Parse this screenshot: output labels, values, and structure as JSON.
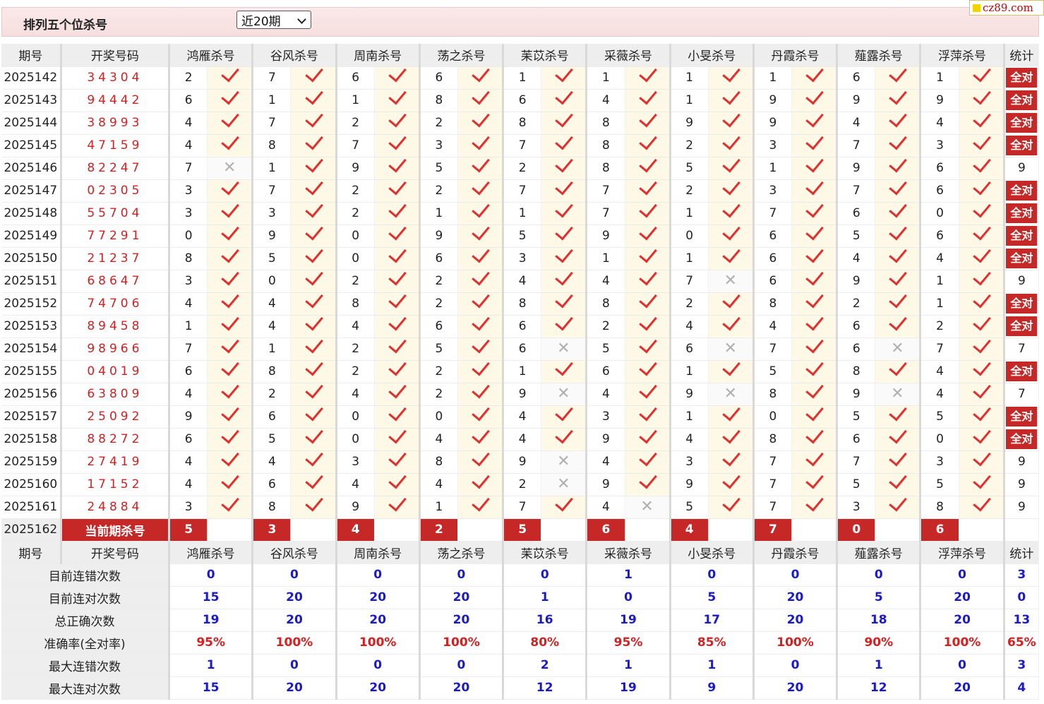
{
  "header": {
    "title": "排列五个位杀号",
    "period_select": "近20期",
    "logo": "cz89.com"
  },
  "columns": {
    "issue": "期号",
    "draw": "开奖号码",
    "experts": [
      "鸿雁杀号",
      "谷风杀号",
      "周南杀号",
      "荡之杀号",
      "苿苡杀号",
      "采薇杀号",
      "小旻杀号",
      "丹霞杀号",
      "薤露杀号",
      "浮萍杀号"
    ],
    "stat": "统计"
  },
  "rows": [
    {
      "issue": "2025142",
      "draw": "34304",
      "kills": [
        [
          "2",
          1
        ],
        [
          "7",
          1
        ],
        [
          "6",
          1
        ],
        [
          "6",
          1
        ],
        [
          "1",
          1
        ],
        [
          "1",
          1
        ],
        [
          "1",
          1
        ],
        [
          "1",
          1
        ],
        [
          "6",
          1
        ],
        [
          "1",
          1
        ]
      ],
      "stat": "全对"
    },
    {
      "issue": "2025143",
      "draw": "94442",
      "kills": [
        [
          "6",
          1
        ],
        [
          "1",
          1
        ],
        [
          "1",
          1
        ],
        [
          "8",
          1
        ],
        [
          "6",
          1
        ],
        [
          "4",
          1
        ],
        [
          "1",
          1
        ],
        [
          "9",
          1
        ],
        [
          "9",
          1
        ],
        [
          "9",
          1
        ]
      ],
      "stat": "全对"
    },
    {
      "issue": "2025144",
      "draw": "38993",
      "kills": [
        [
          "4",
          1
        ],
        [
          "7",
          1
        ],
        [
          "2",
          1
        ],
        [
          "2",
          1
        ],
        [
          "8",
          1
        ],
        [
          "8",
          1
        ],
        [
          "9",
          1
        ],
        [
          "9",
          1
        ],
        [
          "4",
          1
        ],
        [
          "4",
          1
        ]
      ],
      "stat": "全对"
    },
    {
      "issue": "2025145",
      "draw": "47159",
      "kills": [
        [
          "4",
          1
        ],
        [
          "8",
          1
        ],
        [
          "7",
          1
        ],
        [
          "3",
          1
        ],
        [
          "7",
          1
        ],
        [
          "8",
          1
        ],
        [
          "2",
          1
        ],
        [
          "3",
          1
        ],
        [
          "7",
          1
        ],
        [
          "3",
          1
        ]
      ],
      "stat": "全对"
    },
    {
      "issue": "2025146",
      "draw": "82247",
      "kills": [
        [
          "7",
          0
        ],
        [
          "1",
          1
        ],
        [
          "9",
          1
        ],
        [
          "5",
          1
        ],
        [
          "2",
          1
        ],
        [
          "8",
          1
        ],
        [
          "5",
          1
        ],
        [
          "1",
          1
        ],
        [
          "9",
          1
        ],
        [
          "6",
          1
        ]
      ],
      "stat": "9"
    },
    {
      "issue": "2025147",
      "draw": "02305",
      "kills": [
        [
          "3",
          1
        ],
        [
          "7",
          1
        ],
        [
          "2",
          1
        ],
        [
          "2",
          1
        ],
        [
          "7",
          1
        ],
        [
          "7",
          1
        ],
        [
          "2",
          1
        ],
        [
          "3",
          1
        ],
        [
          "7",
          1
        ],
        [
          "6",
          1
        ]
      ],
      "stat": "全对"
    },
    {
      "issue": "2025148",
      "draw": "55704",
      "kills": [
        [
          "3",
          1
        ],
        [
          "3",
          1
        ],
        [
          "2",
          1
        ],
        [
          "1",
          1
        ],
        [
          "1",
          1
        ],
        [
          "7",
          1
        ],
        [
          "1",
          1
        ],
        [
          "7",
          1
        ],
        [
          "6",
          1
        ],
        [
          "0",
          1
        ]
      ],
      "stat": "全对"
    },
    {
      "issue": "2025149",
      "draw": "77291",
      "kills": [
        [
          "0",
          1
        ],
        [
          "9",
          1
        ],
        [
          "0",
          1
        ],
        [
          "9",
          1
        ],
        [
          "5",
          1
        ],
        [
          "9",
          1
        ],
        [
          "0",
          1
        ],
        [
          "6",
          1
        ],
        [
          "5",
          1
        ],
        [
          "6",
          1
        ]
      ],
      "stat": "全对"
    },
    {
      "issue": "2025150",
      "draw": "21237",
      "kills": [
        [
          "8",
          1
        ],
        [
          "5",
          1
        ],
        [
          "0",
          1
        ],
        [
          "6",
          1
        ],
        [
          "3",
          1
        ],
        [
          "1",
          1
        ],
        [
          "1",
          1
        ],
        [
          "6",
          1
        ],
        [
          "4",
          1
        ],
        [
          "4",
          1
        ]
      ],
      "stat": "全对"
    },
    {
      "issue": "2025151",
      "draw": "68647",
      "kills": [
        [
          "3",
          1
        ],
        [
          "0",
          1
        ],
        [
          "2",
          1
        ],
        [
          "2",
          1
        ],
        [
          "4",
          1
        ],
        [
          "4",
          1
        ],
        [
          "7",
          0
        ],
        [
          "6",
          1
        ],
        [
          "9",
          1
        ],
        [
          "1",
          1
        ]
      ],
      "stat": "9"
    },
    {
      "issue": "2025152",
      "draw": "74706",
      "kills": [
        [
          "4",
          1
        ],
        [
          "4",
          1
        ],
        [
          "8",
          1
        ],
        [
          "2",
          1
        ],
        [
          "8",
          1
        ],
        [
          "8",
          1
        ],
        [
          "2",
          1
        ],
        [
          "8",
          1
        ],
        [
          "2",
          1
        ],
        [
          "1",
          1
        ]
      ],
      "stat": "全对"
    },
    {
      "issue": "2025153",
      "draw": "89458",
      "kills": [
        [
          "1",
          1
        ],
        [
          "4",
          1
        ],
        [
          "4",
          1
        ],
        [
          "6",
          1
        ],
        [
          "6",
          1
        ],
        [
          "2",
          1
        ],
        [
          "4",
          1
        ],
        [
          "4",
          1
        ],
        [
          "6",
          1
        ],
        [
          "2",
          1
        ]
      ],
      "stat": "全对"
    },
    {
      "issue": "2025154",
      "draw": "98966",
      "kills": [
        [
          "7",
          1
        ],
        [
          "1",
          1
        ],
        [
          "2",
          1
        ],
        [
          "5",
          1
        ],
        [
          "6",
          0
        ],
        [
          "5",
          1
        ],
        [
          "6",
          0
        ],
        [
          "7",
          1
        ],
        [
          "6",
          0
        ],
        [
          "7",
          1
        ]
      ],
      "stat": "7"
    },
    {
      "issue": "2025155",
      "draw": "04019",
      "kills": [
        [
          "6",
          1
        ],
        [
          "8",
          1
        ],
        [
          "2",
          1
        ],
        [
          "2",
          1
        ],
        [
          "1",
          1
        ],
        [
          "6",
          1
        ],
        [
          "1",
          1
        ],
        [
          "5",
          1
        ],
        [
          "8",
          1
        ],
        [
          "4",
          1
        ]
      ],
      "stat": "全对"
    },
    {
      "issue": "2025156",
      "draw": "63809",
      "kills": [
        [
          "4",
          1
        ],
        [
          "2",
          1
        ],
        [
          "4",
          1
        ],
        [
          "2",
          1
        ],
        [
          "9",
          0
        ],
        [
          "4",
          1
        ],
        [
          "9",
          0
        ],
        [
          "8",
          1
        ],
        [
          "9",
          0
        ],
        [
          "4",
          1
        ]
      ],
      "stat": "7"
    },
    {
      "issue": "2025157",
      "draw": "25092",
      "kills": [
        [
          "9",
          1
        ],
        [
          "6",
          1
        ],
        [
          "0",
          1
        ],
        [
          "0",
          1
        ],
        [
          "4",
          1
        ],
        [
          "3",
          1
        ],
        [
          "1",
          1
        ],
        [
          "0",
          1
        ],
        [
          "5",
          1
        ],
        [
          "5",
          1
        ]
      ],
      "stat": "全对"
    },
    {
      "issue": "2025158",
      "draw": "88272",
      "kills": [
        [
          "6",
          1
        ],
        [
          "5",
          1
        ],
        [
          "0",
          1
        ],
        [
          "4",
          1
        ],
        [
          "4",
          1
        ],
        [
          "9",
          1
        ],
        [
          "4",
          1
        ],
        [
          "8",
          1
        ],
        [
          "6",
          1
        ],
        [
          "0",
          1
        ]
      ],
      "stat": "全对"
    },
    {
      "issue": "2025159",
      "draw": "27419",
      "kills": [
        [
          "4",
          1
        ],
        [
          "4",
          1
        ],
        [
          "3",
          1
        ],
        [
          "8",
          1
        ],
        [
          "9",
          0
        ],
        [
          "4",
          1
        ],
        [
          "3",
          1
        ],
        [
          "7",
          1
        ],
        [
          "7",
          1
        ],
        [
          "3",
          1
        ]
      ],
      "stat": "9"
    },
    {
      "issue": "2025160",
      "draw": "17152",
      "kills": [
        [
          "4",
          1
        ],
        [
          "6",
          1
        ],
        [
          "4",
          1
        ],
        [
          "4",
          1
        ],
        [
          "2",
          0
        ],
        [
          "9",
          1
        ],
        [
          "9",
          1
        ],
        [
          "7",
          1
        ],
        [
          "5",
          1
        ],
        [
          "5",
          1
        ]
      ],
      "stat": "9"
    },
    {
      "issue": "2025161",
      "draw": "24884",
      "kills": [
        [
          "3",
          1
        ],
        [
          "8",
          1
        ],
        [
          "9",
          1
        ],
        [
          "1",
          1
        ],
        [
          "7",
          1
        ],
        [
          "4",
          0
        ],
        [
          "5",
          1
        ],
        [
          "7",
          1
        ],
        [
          "3",
          1
        ],
        [
          "8",
          1
        ]
      ],
      "stat": "9"
    }
  ],
  "current": {
    "issue": "2025162",
    "label": "当前期杀号",
    "kills": [
      "5",
      "3",
      "4",
      "2",
      "5",
      "6",
      "4",
      "7",
      "0",
      "6"
    ]
  },
  "summary": [
    {
      "label": "目前连错次数",
      "values": [
        "0",
        "0",
        "0",
        "0",
        "0",
        "1",
        "0",
        "0",
        "0",
        "0",
        "3"
      ],
      "color": "blue"
    },
    {
      "label": "目前连对次数",
      "values": [
        "15",
        "20",
        "20",
        "20",
        "1",
        "0",
        "5",
        "20",
        "5",
        "20",
        "0"
      ],
      "color": "blue"
    },
    {
      "label": "总正确次数",
      "values": [
        "19",
        "20",
        "20",
        "20",
        "16",
        "19",
        "17",
        "20",
        "18",
        "20",
        "13"
      ],
      "color": "blue"
    },
    {
      "label": "准确率(全对率)",
      "values": [
        "95%",
        "100%",
        "100%",
        "100%",
        "80%",
        "95%",
        "85%",
        "100%",
        "90%",
        "100%",
        "65%"
      ],
      "color": "red"
    },
    {
      "label": "最大连错次数",
      "values": [
        "1",
        "0",
        "0",
        "0",
        "2",
        "1",
        "1",
        "0",
        "1",
        "0",
        "3"
      ],
      "color": "blue"
    },
    {
      "label": "最大连对次数",
      "values": [
        "15",
        "20",
        "20",
        "20",
        "12",
        "19",
        "9",
        "20",
        "12",
        "20",
        "4"
      ],
      "color": "blue"
    }
  ],
  "colors": {
    "accent_red": "#c62828",
    "draw_red": "#d42020",
    "stat_blue": "#1a1acc",
    "mark_bg": "#fdf9e6"
  },
  "icons": {
    "right": "check-icon",
    "wrong": "cross-icon"
  }
}
